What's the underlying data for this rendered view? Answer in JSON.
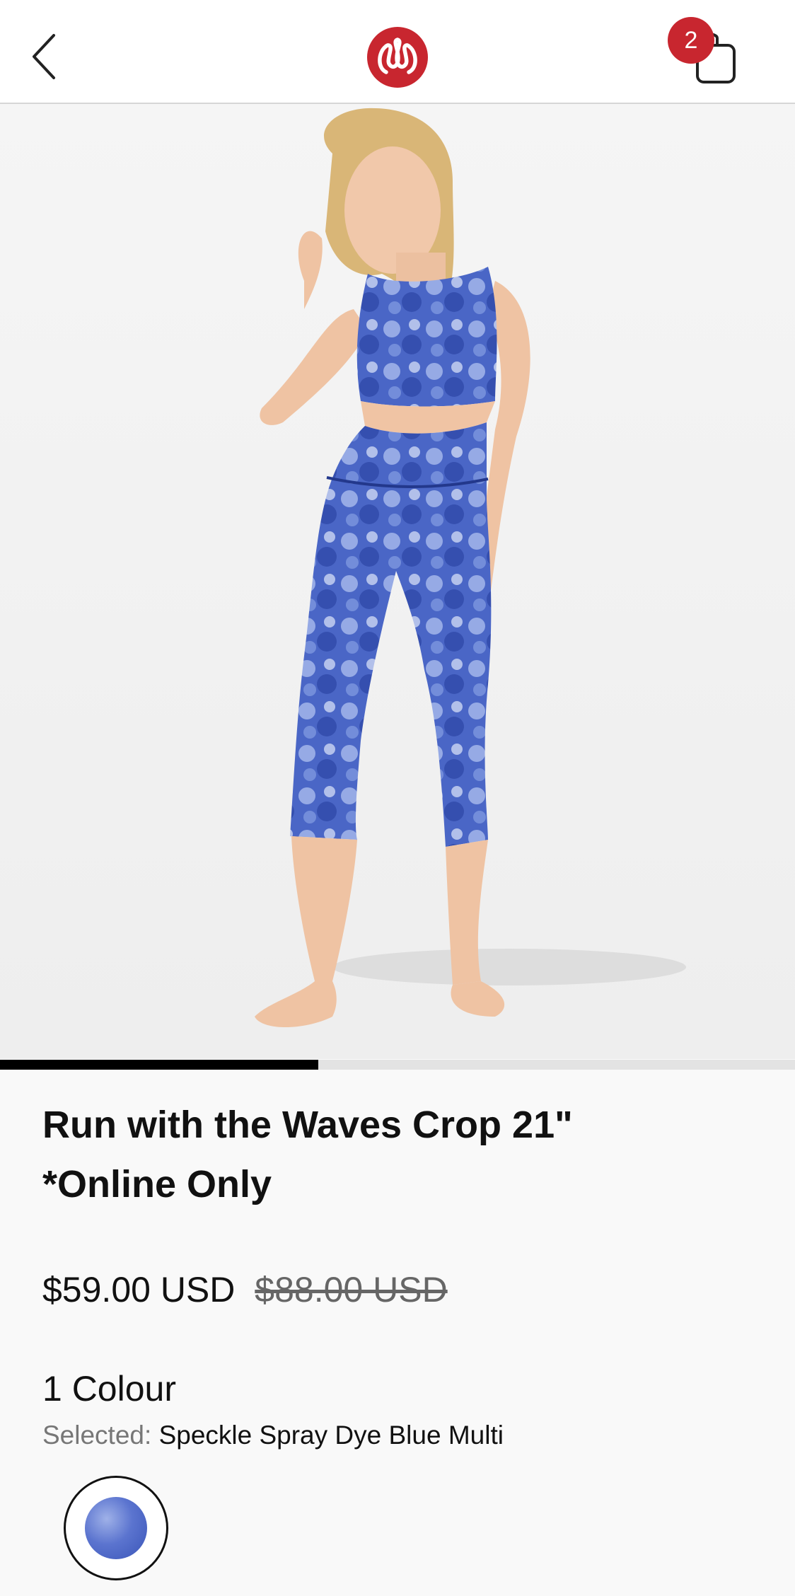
{
  "header": {
    "back_icon": "chevron-left-icon",
    "logo_icon": "lululemon-logo",
    "bag_icon": "shopping-bag-icon",
    "bag_count": "2",
    "brand_color": "#c8262f"
  },
  "gallery": {
    "progress": 0.4
  },
  "product": {
    "title_line1": "Run with the Waves Crop 21\"",
    "title_line2": "*Online Only",
    "price_current": "$59.00 USD",
    "price_original": "$88.00 USD",
    "colour_count": "1 Colour",
    "selected_label": "Selected:",
    "selected_value": "Speckle Spray Dye Blue Multi",
    "swatch_color": "#5b74cf"
  }
}
